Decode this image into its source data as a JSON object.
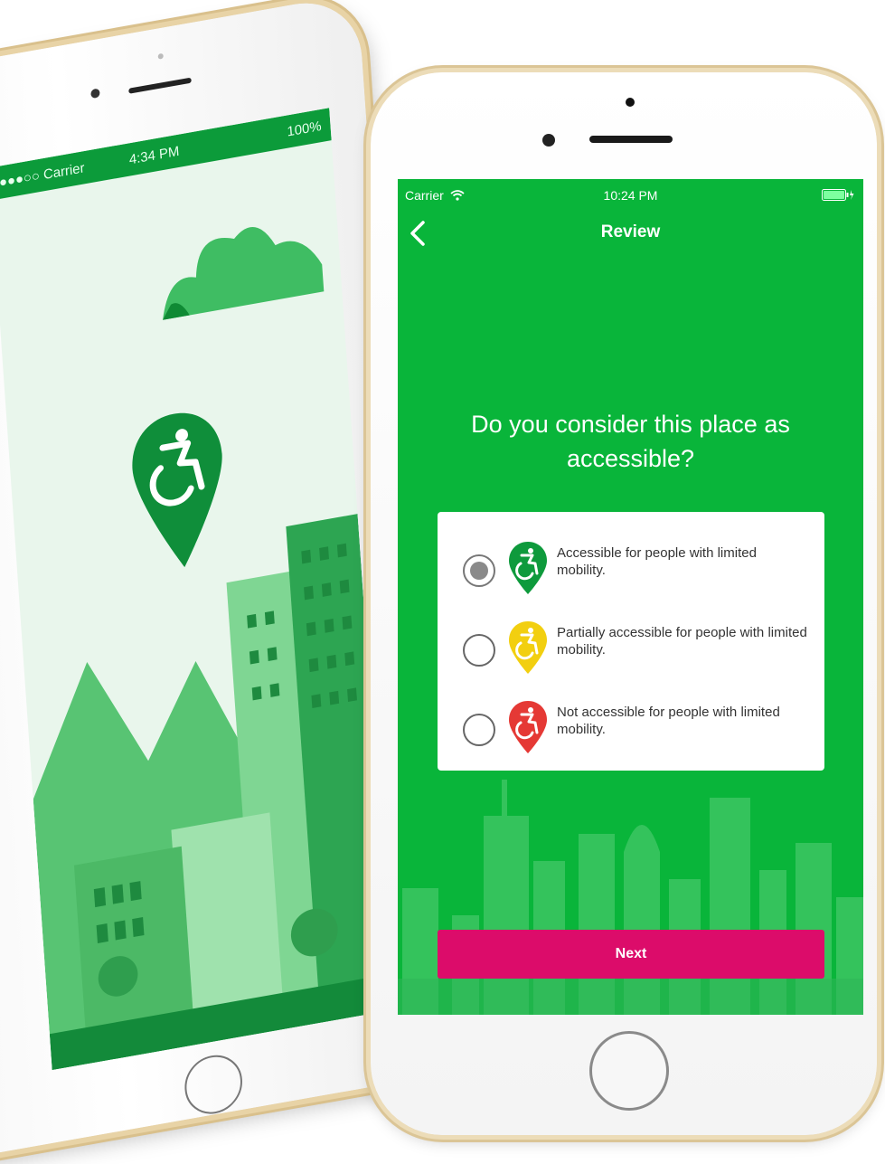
{
  "left_phone": {
    "status": {
      "carrier": "●●●○○ Carrier",
      "time": "4:34 PM",
      "battery": "100%"
    }
  },
  "right_phone": {
    "status": {
      "carrier": "Carrier",
      "time": "10:24 PM"
    },
    "nav": {
      "title": "Review"
    },
    "question": "Do you consider this place as accessible?",
    "options": [
      {
        "label": "Accessible for people with limited mobility.",
        "color": "#0e9a3c",
        "selected": true
      },
      {
        "label": "Partially accessible for people with limited mobility.",
        "color": "#f2cf10",
        "selected": false
      },
      {
        "label": "Not accessible for people with limited mobility.",
        "color": "#e53935",
        "selected": false
      }
    ],
    "next_label": "Next"
  },
  "colors": {
    "screen_green": "#09b53a",
    "next_pink": "#dc0c6a",
    "dark_green": "#0c9b3a"
  },
  "icons": [
    "wifi-icon",
    "battery-icon",
    "back-chevron-icon",
    "wheelchair-pin-icon"
  ]
}
